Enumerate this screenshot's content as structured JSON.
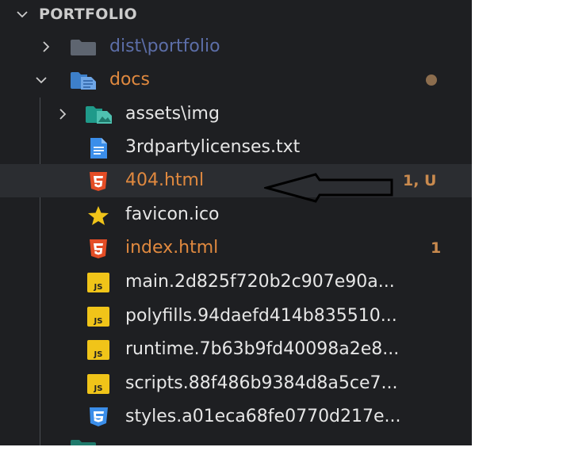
{
  "explorer": {
    "section_title": "PORTFOLIO",
    "items": [
      {
        "label": "dist\\portfolio",
        "icon": "folder-icon",
        "color": "#5c6ea8"
      },
      {
        "label": "docs",
        "icon": "folder-open-icon",
        "color": "#e0893f",
        "modified_dot": "#8c6d4e"
      },
      {
        "label": "assets\\img",
        "icon": "image-folder-icon",
        "color": "#e6e6e6"
      },
      {
        "label": "3rdpartylicenses.txt",
        "icon": "text-file-icon",
        "color": "#e6e6e6"
      },
      {
        "label": "404.html",
        "icon": "html5-icon",
        "color": "#e0893f",
        "badge": "1, U",
        "selected": true
      },
      {
        "label": "favicon.ico",
        "icon": "star-icon",
        "color": "#e6e6e6"
      },
      {
        "label": "index.html",
        "icon": "html5-icon",
        "color": "#e0893f",
        "badge": "1"
      },
      {
        "label": "main.2d825f720b2c907e90a...",
        "icon": "js-file-icon",
        "color": "#e6e6e6"
      },
      {
        "label": "polyfills.94daefd414b835510...",
        "icon": "js-file-icon",
        "color": "#e6e6e6"
      },
      {
        "label": "runtime.7b63b9fd40098a2e8...",
        "icon": "js-file-icon",
        "color": "#e6e6e6"
      },
      {
        "label": "scripts.88f486b9384d8a5ce7...",
        "icon": "js-file-icon",
        "color": "#e6e6e6"
      },
      {
        "label": "styles.a01eca68fe0770d217e...",
        "icon": "css-file-icon",
        "color": "#e6e6e6"
      }
    ]
  },
  "colors": {
    "background": "#1e1f22",
    "selected_row": "#2b2d31",
    "badge": "#c98a4e",
    "annotation_arrow": "#000000"
  },
  "annotation": {
    "icon": "left-arrow-annotation-icon"
  }
}
